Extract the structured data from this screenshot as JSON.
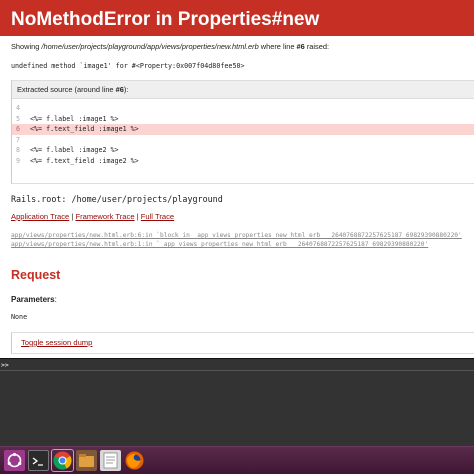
{
  "error": {
    "title": "NoMethodError in Properties#new",
    "showing_prefix": "Showing ",
    "showing_path": "/home/user/projects/playground/app/views/properties/new.html.erb",
    "showing_middle": " where line ",
    "showing_line": "#6",
    "showing_suffix": " raised:",
    "message": "undefined method `image1' for #<Property:0x007f04d80fee50>"
  },
  "source": {
    "title_prefix": "Extracted source (around line ",
    "title_line": "#6",
    "title_suffix": "):",
    "lines": [
      {
        "num": "4",
        "code": ""
      },
      {
        "num": "5",
        "code": "<%= f.label :image1 %>"
      },
      {
        "num": "6",
        "code": "<%= f.text_field :image1 %>"
      },
      {
        "num": "7",
        "code": ""
      },
      {
        "num": "8",
        "code": "<%= f.label :image2 %>"
      },
      {
        "num": "9",
        "code": "<%= f.text_field :image2 %>"
      }
    ]
  },
  "rails_root": "Rails.root: /home/user/projects/playground",
  "trace": {
    "application": "Application Trace",
    "framework": "Framework Trace",
    "full": "Full Trace",
    "sep": " | ",
    "lines": [
      "app/views/properties/new.html.erb:6:in `block in _app_views_properties_new_html_erb___2640768872257625187_69829390880220'",
      "app/views/properties/new.html.erb:1:in `_app_views_properties_new_html_erb___2640768872257625187_69829390880220'"
    ]
  },
  "request": {
    "heading": "Request",
    "params_label": "Parameters",
    "params_colon": ":",
    "params_value": "None",
    "toggle_session": "Toggle session dump"
  },
  "console": {
    "prompt": ">>"
  },
  "taskbar": {
    "icons": [
      "ubuntu-dash-icon",
      "terminal-icon",
      "chrome-icon",
      "file-manager-icon",
      "text-editor-icon",
      "firefox-icon"
    ]
  },
  "colors": {
    "header_bg": "#c52f24",
    "highlight_line": "#fbd3d1",
    "link": "#980905",
    "console_bg": "#333333"
  }
}
